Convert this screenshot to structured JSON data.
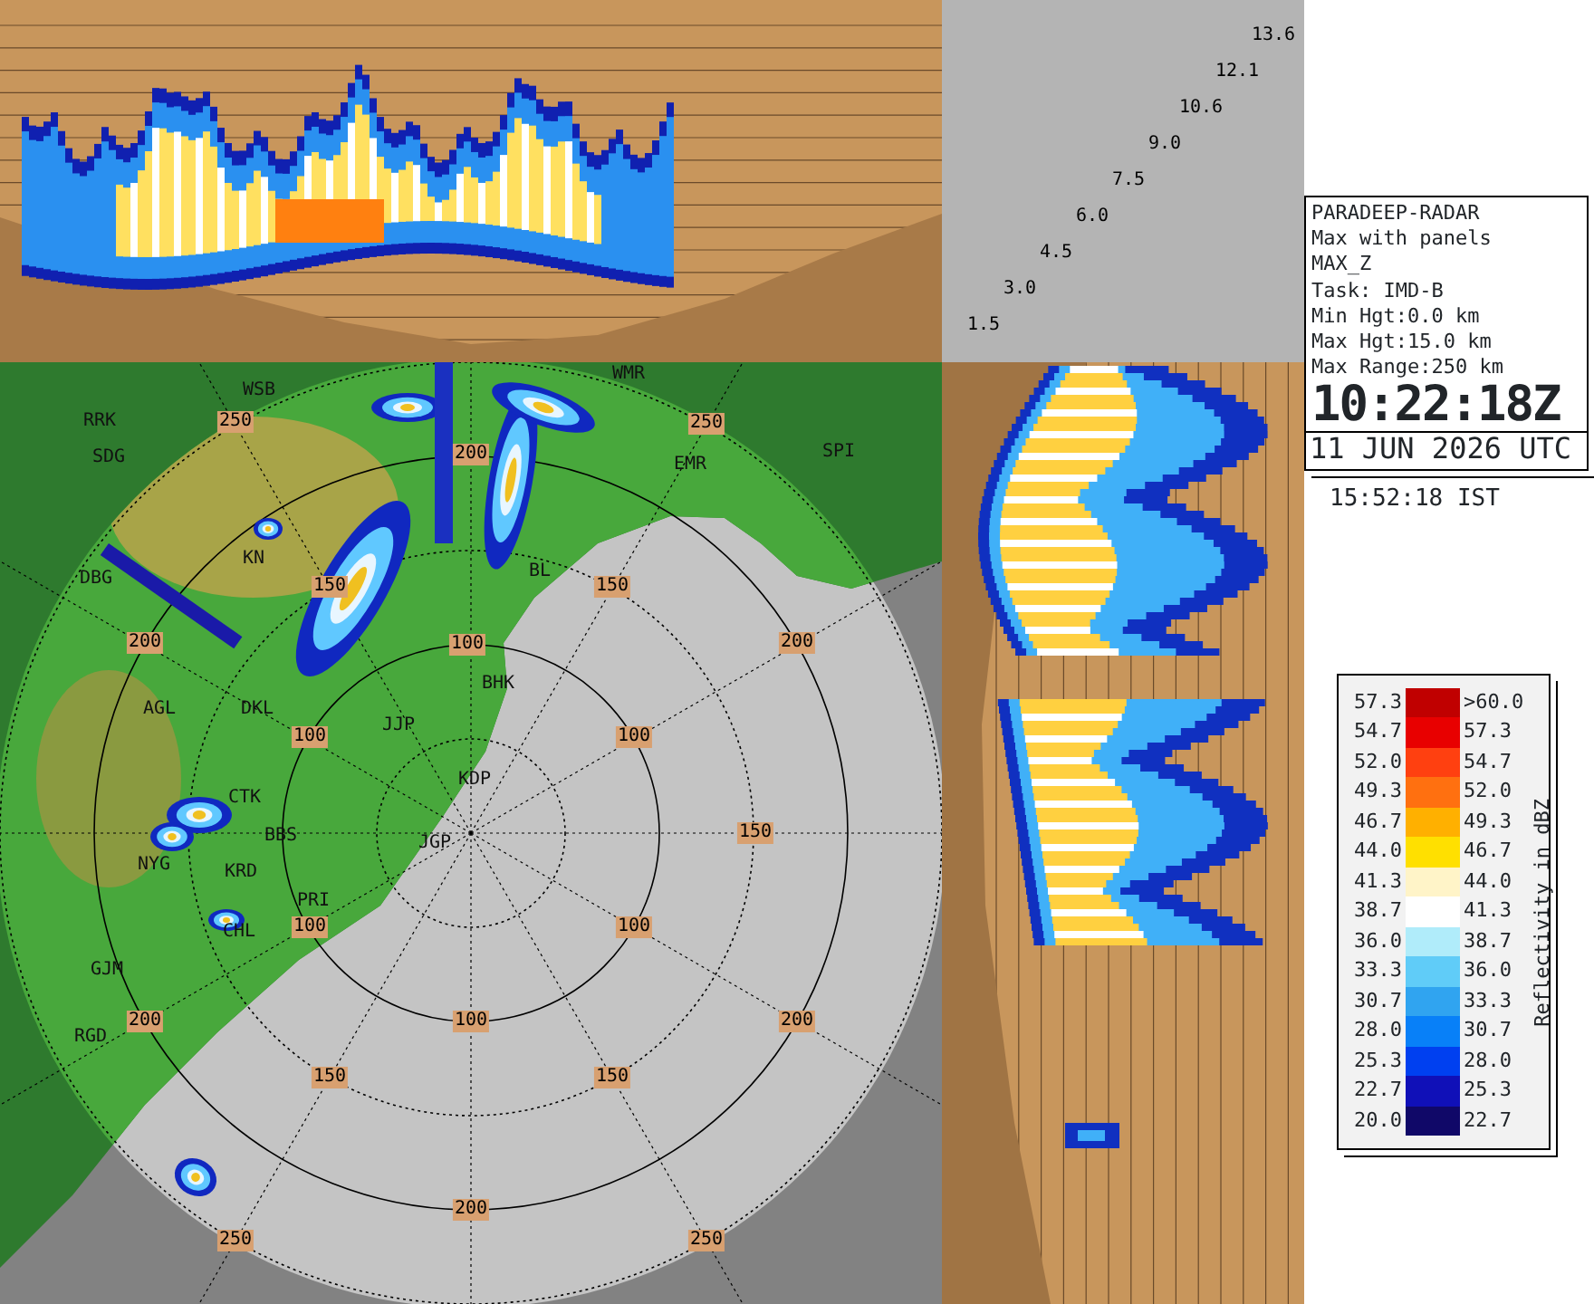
{
  "height_axis": {
    "labels": [
      "1.5",
      "3.0",
      "4.5",
      "6.0",
      "7.5",
      "9.0",
      "10.6",
      "12.1",
      "13.6"
    ]
  },
  "info": {
    "lines": [
      "PARADEEP-RADAR",
      "Max with panels",
      "MAX_Z",
      "Task: IMD-B",
      "Min Hgt:0.0 km",
      "Max Hgt:15.0 km",
      "Max Range:250 km"
    ],
    "time": "10:22:18Z",
    "date": "11 JUN 2026 UTC",
    "local_time": "15:52:18 IST"
  },
  "map": {
    "range_labels": [
      "250",
      "250",
      "200",
      "150",
      "150",
      "200",
      "100",
      "200",
      "100",
      "100",
      "150",
      "100",
      "100",
      "200",
      "100",
      "200",
      "150",
      "150",
      "200",
      "250",
      "250"
    ],
    "station_labels": [
      "WMR",
      "WSB",
      "RRK",
      "SPI",
      "SDG",
      "EMR",
      "KN",
      "BL",
      "DBG",
      "BHK",
      "AGL",
      "DKL",
      "JJP",
      "KDP",
      "CTK",
      "BBS",
      "JGP",
      "NYG",
      "KRD",
      "PRI",
      "CHL",
      "GJM",
      "RGD"
    ]
  },
  "legend": {
    "title": "Reflectivity in dBZ",
    "bins": [
      {
        "low": "57.3",
        "high": ">60.0",
        "color": "#c00000"
      },
      {
        "low": "54.7",
        "high": "57.3",
        "color": "#e80000"
      },
      {
        "low": "52.0",
        "high": "54.7",
        "color": "#ff4010"
      },
      {
        "low": "49.3",
        "high": "52.0",
        "color": "#ff7010"
      },
      {
        "low": "46.7",
        "high": "49.3",
        "color": "#ffb000"
      },
      {
        "low": "44.0",
        "high": "46.7",
        "color": "#ffe000"
      },
      {
        "low": "41.3",
        "high": "44.0",
        "color": "#fff4c8"
      },
      {
        "low": "38.7",
        "high": "41.3",
        "color": "#ffffff"
      },
      {
        "low": "36.0",
        "high": "38.7",
        "color": "#b0ecfa"
      },
      {
        "low": "33.3",
        "high": "36.0",
        "color": "#60ccf8"
      },
      {
        "low": "30.7",
        "high": "33.3",
        "color": "#30a4f0"
      },
      {
        "low": "28.0",
        "high": "30.7",
        "color": "#0880f8"
      },
      {
        "low": "25.3",
        "high": "28.0",
        "color": "#0040f0"
      },
      {
        "low": "22.7",
        "high": "25.3",
        "color": "#1010b8"
      },
      {
        "low": "20.0",
        "high": "22.7",
        "color": "#100868"
      }
    ]
  }
}
